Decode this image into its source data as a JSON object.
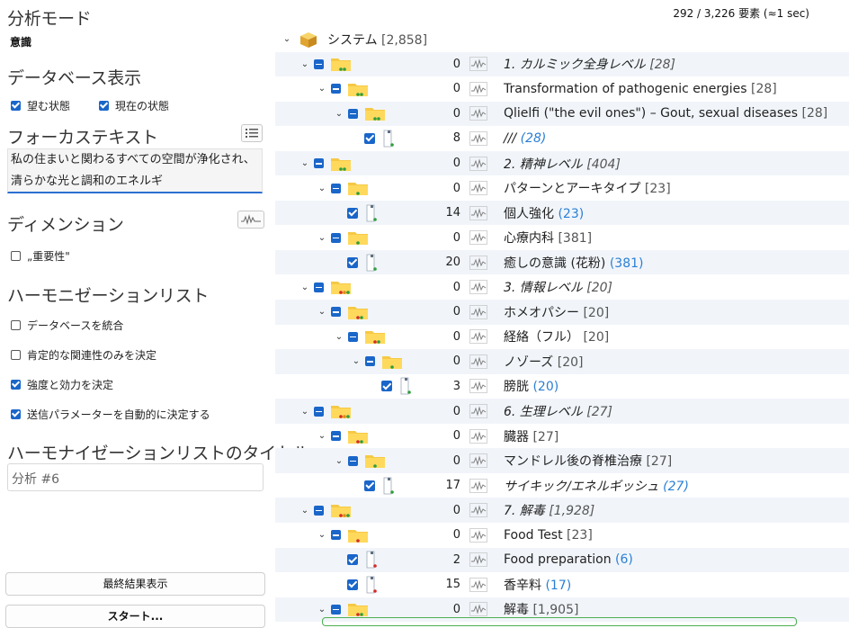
{
  "left": {
    "analysis_mode_title": "分析モード",
    "analysis_mode_value": "意識",
    "db_display_title": "データベース表示",
    "desired_state_label": "望む状態",
    "desired_state_checked": true,
    "current_state_label": "現在の状態",
    "current_state_checked": true,
    "focus_text_title": "フォーカステキスト",
    "focus_text_value": "私の住まいと関わるすべての空間が浄化され、清らかな光と調和のエネルギ",
    "dimension_title": "ディメンション",
    "importance_label": "„重要性\"",
    "importance_checked": false,
    "harmonization_title": "ハーモニゼーションリスト",
    "options": [
      {
        "label": "データベースを統合",
        "checked": false
      },
      {
        "label": "肯定的な関連性のみを決定",
        "checked": false
      },
      {
        "label": "強度と効力を決定",
        "checked": true
      },
      {
        "label": "送信パラメーターを自動的に決定する",
        "checked": true
      }
    ],
    "list_title_title": "ハーモナイゼーションリストのタイトル",
    "list_title_value": "分析 #6",
    "final_result_button": "最終結果表示",
    "start_button": "スタート..."
  },
  "status": "292 / 3,226 要素 (≈1 sec)",
  "tree": {
    "root": {
      "label": "システム",
      "count": "[2,858]"
    },
    "rows": [
      {
        "level": 1,
        "kind": "folder",
        "num": "0",
        "label": "1. カルミック全身レベル",
        "count": "[28]",
        "italic": true,
        "dots": [
          "#2e9e3e",
          "#2e9e3e"
        ]
      },
      {
        "level": 2,
        "kind": "folder",
        "num": "0",
        "label": "Transformation of pathogenic energies",
        "count": "[28]",
        "italic": false,
        "dots": [
          "#2e9e3e",
          "#2e9e3e"
        ]
      },
      {
        "level": 3,
        "kind": "folder",
        "num": "0",
        "label": "Qlielfi (\"the evil ones\") – Gout, sexual diseases",
        "count": "[28]",
        "italic": false,
        "dots": [
          "#2e9e3e",
          "#2e9e3e"
        ]
      },
      {
        "level": 4,
        "kind": "doc",
        "num": "8",
        "label": "///",
        "count": "(28)",
        "italic": true,
        "dots": [
          "#2e9e3e"
        ]
      },
      {
        "level": 1,
        "kind": "folder",
        "num": "0",
        "label": "2. 精神レベル",
        "count": "[404]",
        "italic": true,
        "dots": [
          "#2e9e3e",
          "#2e9e3e"
        ]
      },
      {
        "level": 2,
        "kind": "folder",
        "num": "0",
        "label": "パターンとアーキタイプ",
        "count": "[23]",
        "italic": false,
        "dots": [
          "#2e9e3e"
        ]
      },
      {
        "level": 3,
        "kind": "doc",
        "num": "14",
        "label": "個人強化",
        "count": "(23)",
        "italic": false,
        "dots": [
          "#2e9e3e"
        ]
      },
      {
        "level": 2,
        "kind": "folder",
        "num": "0",
        "label": "心療内科",
        "count": "[381]",
        "italic": false,
        "dots": [
          "#2e9e3e"
        ]
      },
      {
        "level": 3,
        "kind": "doc",
        "num": "20",
        "label": "癒しの意識 (花粉)",
        "count": "(381)",
        "italic": false,
        "dots": [
          "#2e9e3e"
        ]
      },
      {
        "level": 1,
        "kind": "folder",
        "num": "0",
        "label": "3. 情報レベル",
        "count": "[20]",
        "italic": true,
        "dots": [
          "#d42a2a",
          "#e08a1a",
          "#2e9e3e"
        ]
      },
      {
        "level": 2,
        "kind": "folder",
        "num": "0",
        "label": "ホメオパシー",
        "count": "[20]",
        "italic": false,
        "dots": [
          "#d42a2a",
          "#2e9e3e"
        ]
      },
      {
        "level": 3,
        "kind": "folder",
        "num": "0",
        "label": "経絡（フル）",
        "count": "[20]",
        "italic": false,
        "dots": [
          "#d42a2a",
          "#2e9e3e"
        ]
      },
      {
        "level": 4,
        "kind": "folder",
        "num": "0",
        "label": "ノゾーズ",
        "count": "[20]",
        "italic": false,
        "dots": [
          "#2e9e3e"
        ]
      },
      {
        "level": 5,
        "kind": "doc",
        "num": "3",
        "label": "膀胱",
        "count": "(20)",
        "italic": false,
        "dots": [
          "#2e9e3e"
        ]
      },
      {
        "level": 1,
        "kind": "folder",
        "num": "0",
        "label": "6. 生理レベル",
        "count": "[27]",
        "italic": true,
        "dots": [
          "#d42a2a",
          "#e08a1a",
          "#2e9e3e"
        ]
      },
      {
        "level": 2,
        "kind": "folder",
        "num": "0",
        "label": "臓器",
        "count": "[27]",
        "italic": false,
        "dots": [
          "#d42a2a",
          "#2e9e3e"
        ]
      },
      {
        "level": 3,
        "kind": "folder",
        "num": "0",
        "label": "マンドレル後の脊椎治療",
        "count": "[27]",
        "italic": false,
        "dots": [
          "#2e9e3e"
        ]
      },
      {
        "level": 4,
        "kind": "doc",
        "num": "17",
        "label": "サイキック/エネルギッシュ",
        "count": "(27)",
        "italic": true,
        "dots": [
          "#2e9e3e"
        ]
      },
      {
        "level": 1,
        "kind": "folder",
        "num": "0",
        "label": "7. 解毒",
        "count": "[1,928]",
        "italic": true,
        "dots": [
          "#d42a2a",
          "#e08a1a",
          "#2e9e3e"
        ]
      },
      {
        "level": 2,
        "kind": "folder",
        "num": "0",
        "label": "Food Test",
        "count": "[23]",
        "italic": false,
        "dots": [
          "#d42a2a"
        ]
      },
      {
        "level": 3,
        "kind": "doc",
        "num": "2",
        "label": "Food preparation",
        "count": "(6)",
        "italic": false,
        "dots": [
          "#d42a2a"
        ]
      },
      {
        "level": 3,
        "kind": "doc",
        "num": "15",
        "label": "香辛料",
        "count": "(17)",
        "italic": false,
        "dots": [
          "#d42a2a"
        ]
      },
      {
        "level": 2,
        "kind": "folder",
        "num": "0",
        "label": "解毒",
        "count": "[1,905]",
        "italic": false,
        "dots": [
          "#d42a2a",
          "#2e9e3e"
        ]
      }
    ]
  }
}
